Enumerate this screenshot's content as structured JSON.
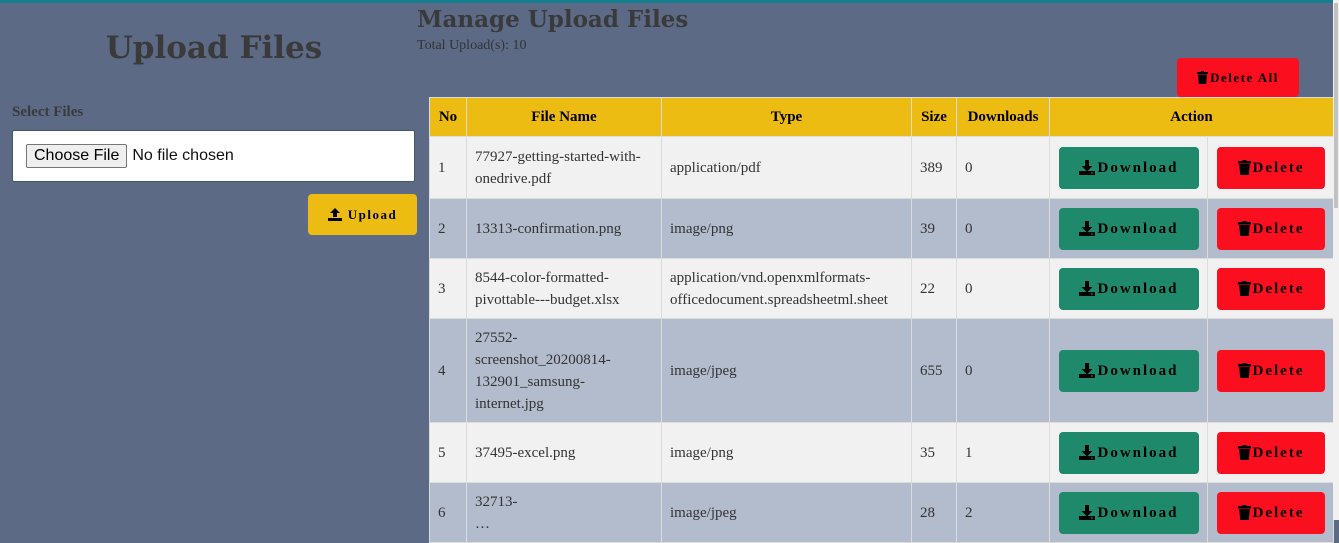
{
  "left_panel": {
    "title": "Upload Files",
    "select_label": "Select Files",
    "file_input": {
      "button_label": "Choose File",
      "status": "No file chosen"
    },
    "upload_button": {
      "label": "Upload",
      "icon": "upload-icon"
    }
  },
  "right_panel": {
    "title": "Manage Upload Files",
    "total_label": "Total Upload(s): 10",
    "delete_all_button": {
      "label": "Delete All",
      "icon": "trash-icon"
    }
  },
  "table": {
    "headers": [
      "No",
      "File Name",
      "Type",
      "Size",
      "Downloads",
      "Action"
    ],
    "rows": [
      {
        "no": "1",
        "name": "77927-getting-started-with-onedrive.pdf",
        "name_lines": [
          "77927-getting-started-with-",
          "onedrive.pdf"
        ],
        "type_lines": [
          "application/pdf"
        ],
        "size": "389",
        "downloads": "0"
      },
      {
        "no": "2",
        "name": "13313-confirmation.png",
        "name_lines": [
          "13313-confirmation.png"
        ],
        "type_lines": [
          "image/png"
        ],
        "size": "39",
        "downloads": "0"
      },
      {
        "no": "3",
        "name": "8544-color-formatted-pivottable---budget.xlsx",
        "name_lines": [
          "8544-color-formatted-",
          "pivottable---budget.xlsx"
        ],
        "type_lines": [
          "application/vnd.openxmlformats-",
          "officedocument.spreadsheetml.sheet"
        ],
        "size": "22",
        "downloads": "0"
      },
      {
        "no": "4",
        "name": "27552-screenshot_20200814-132901_samsung-internet.jpg",
        "name_lines": [
          "27552-",
          "screenshot_20200814-",
          "132901_samsung-",
          "internet.jpg"
        ],
        "type_lines": [
          "image/jpeg"
        ],
        "size": "655",
        "downloads": "0"
      },
      {
        "no": "5",
        "name": "37495-excel.png",
        "name_lines": [
          "37495-excel.png"
        ],
        "type_lines": [
          "image/png"
        ],
        "size": "35",
        "downloads": "1"
      },
      {
        "no": "6",
        "name": "32713-…",
        "name_lines": [
          "32713-",
          "…"
        ],
        "type_lines": [
          "image/jpeg"
        ],
        "size": "28",
        "downloads": "2"
      }
    ],
    "download_label": "Download",
    "delete_label": "Delete"
  },
  "colors": {
    "background": "#5d6a86",
    "accent_yellow": "#edbc13",
    "download_green": "#1e8a6b",
    "delete_red": "#fb0f1e",
    "row_light": "#f1f1f1",
    "row_dark": "#b3bccd",
    "top_bar": "#157f8f"
  }
}
